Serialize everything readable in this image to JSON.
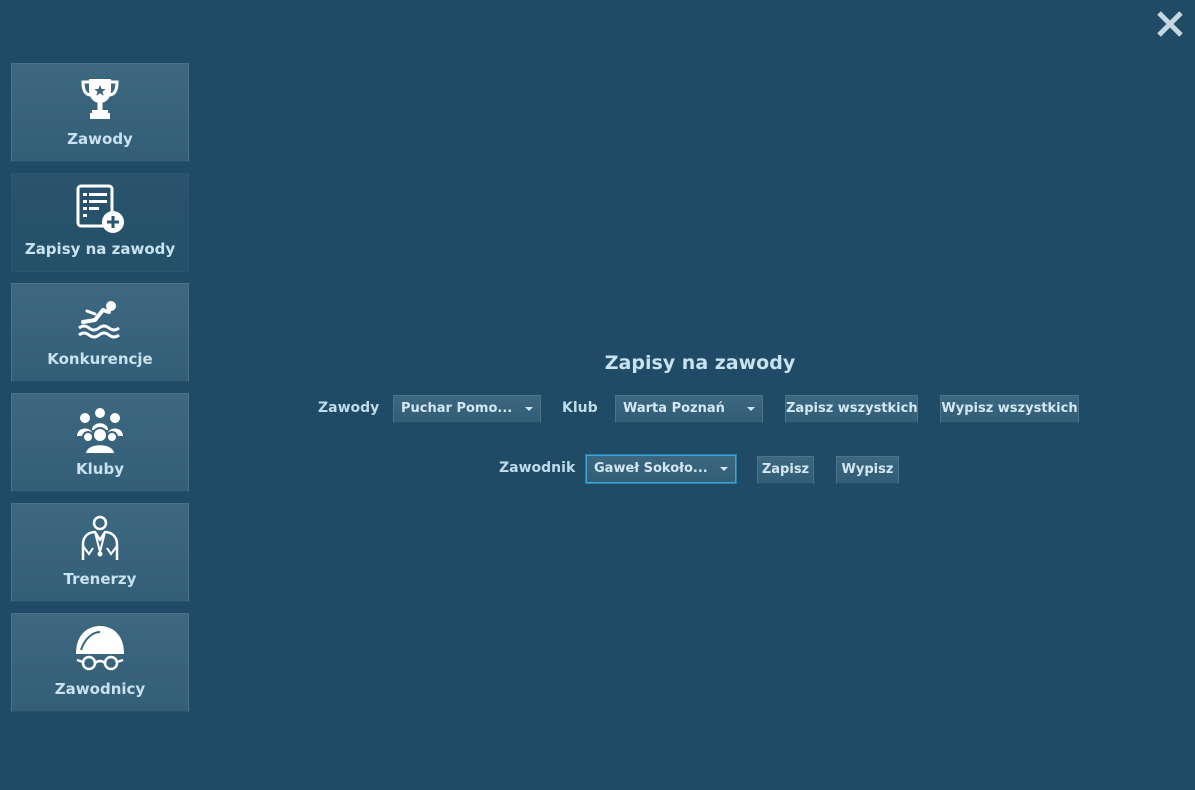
{
  "window": {
    "close_icon": "close-icon"
  },
  "sidebar": {
    "items": [
      {
        "label": "Zawody",
        "icon": "trophy-icon"
      },
      {
        "label": "Zapisy na zawody",
        "icon": "list-add-icon"
      },
      {
        "label": "Konkurencje",
        "icon": "swimmer-icon"
      },
      {
        "label": "Kluby",
        "icon": "group-icon"
      },
      {
        "label": "Trenerzy",
        "icon": "coach-icon"
      },
      {
        "label": "Zawodnicy",
        "icon": "swim-cap-goggles-icon"
      }
    ],
    "active_index": 1
  },
  "main": {
    "title": "Zapisy na zawody",
    "competition_label": "Zawody",
    "competition_value": "Puchar Pomo...",
    "club_label": "Klub",
    "club_value": "Warta Poznań",
    "register_all_label": "Zapisz wszystkich",
    "unregister_all_label": "Wypisz wszystkich",
    "swimmer_label": "Zawodnik",
    "swimmer_value": "Gaweł Sokoło...",
    "register_label": "Zapisz",
    "unregister_label": "Wypisz"
  },
  "colors": {
    "background": "#1f4b66",
    "panel": "#3a657e",
    "text": "#c8e2ee",
    "focus": "#3aa7d9"
  }
}
